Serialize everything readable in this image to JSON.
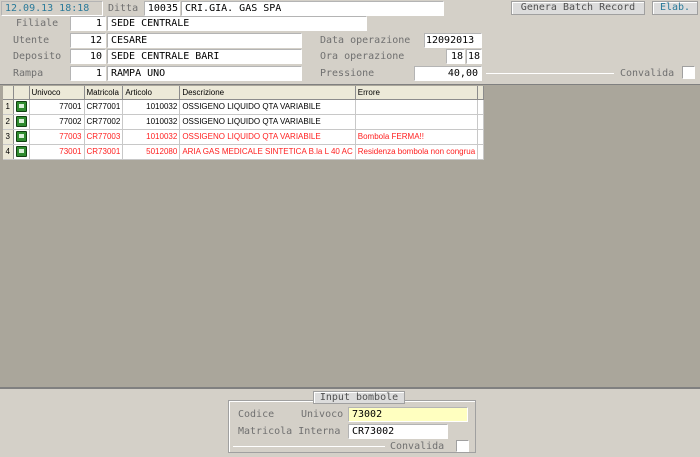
{
  "header": {
    "datetime": "12.09.13 18:18",
    "ditta_label": "Ditta",
    "ditta_code": "10035",
    "ditta_name": "CRI.GIA. GAS SPA",
    "genera_button": "Genera Batch Record",
    "elab_button": "Elab."
  },
  "form": {
    "filiale_label": "Filiale",
    "filiale_code": "1",
    "filiale_name": "SEDE CENTRALE",
    "utente_label": "Utente",
    "utente_code": "12",
    "utente_name": "CESARE",
    "deposito_label": "Deposito",
    "deposito_code": "10",
    "deposito_name": "SEDE CENTRALE BARI",
    "rampa_label": "Rampa",
    "rampa_code": "1",
    "rampa_name": "RAMPA UNO",
    "data_label": "Data operazione",
    "data_value": "12092013",
    "ora_label": "Ora  operazione",
    "ora_hh": "18",
    "ora_mm": "18",
    "pressione_label": "Pressione",
    "pressione_value": "40,00",
    "convalida_label": "Convalida"
  },
  "grid": {
    "columns": [
      "Univoco",
      "Matricola",
      "Articolo",
      "Descrizione",
      "Errore"
    ],
    "rows": [
      {
        "n": "1",
        "univoco": "77001",
        "matricola": "CR77001",
        "articolo": "1010032",
        "descrizione": "OSSIGENO LIQUIDO QTA VARIABILE",
        "errore": "",
        "error": false
      },
      {
        "n": "2",
        "univoco": "77002",
        "matricola": "CR77002",
        "articolo": "1010032",
        "descrizione": "OSSIGENO LIQUIDO QTA VARIABILE",
        "errore": "",
        "error": false
      },
      {
        "n": "3",
        "univoco": "77003",
        "matricola": "CR77003",
        "articolo": "1010032",
        "descrizione": "OSSIGENO LIQUIDO QTA VARIABILE",
        "errore": "Bombola FERMA!!",
        "error": true
      },
      {
        "n": "4",
        "univoco": "73001",
        "matricola": "CR73001",
        "articolo": "5012080",
        "descrizione": "ARIA GAS MEDICALE SINTETICA B.la L 40 AC",
        "errore": "Residenza bombola non congrua",
        "error": true
      }
    ]
  },
  "input_bombole": {
    "title": "Input bombole",
    "codice_label": "Codice",
    "univoco_label": "Univoco",
    "univoco_value": "73002",
    "matricola_label": "Matricola Interna",
    "matricola_value": "CR73002",
    "convalida_label": "Convalida"
  },
  "colors": {
    "background": "#d4d0c8",
    "grid_background": "#aaa69b",
    "error_text": "#ff2020",
    "highlight_field": "#ffffc0",
    "datetime_text": "#2a7a9a"
  }
}
